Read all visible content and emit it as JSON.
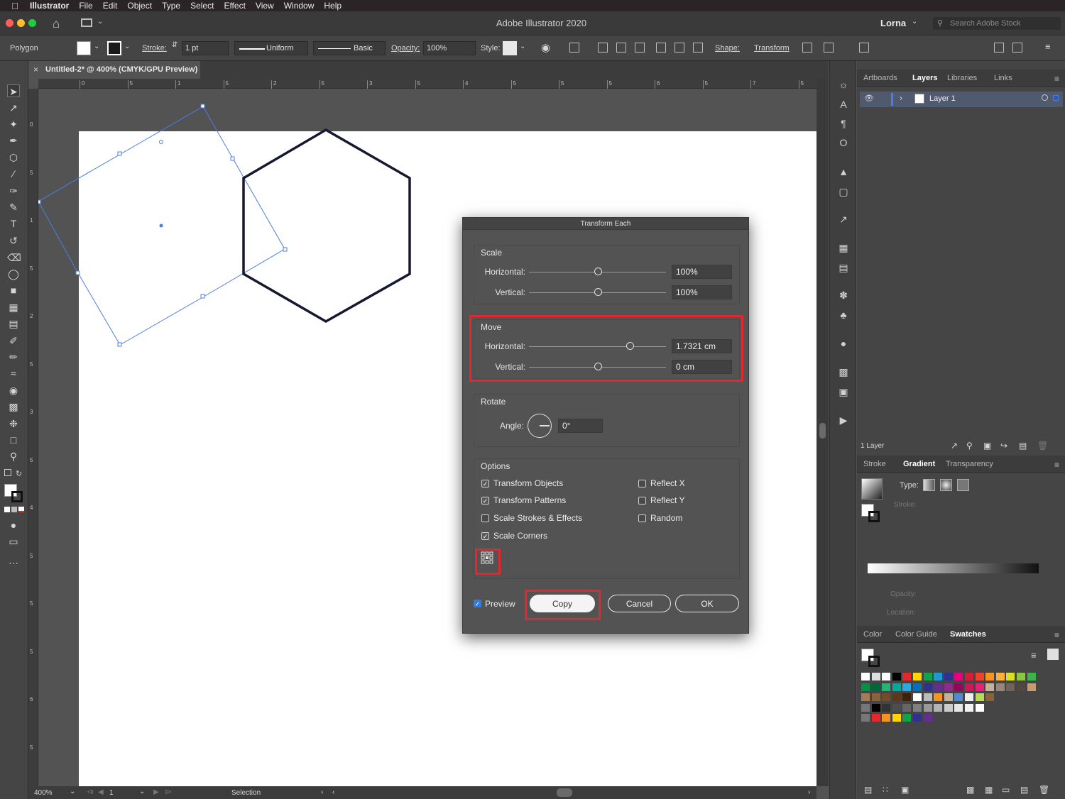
{
  "menubar": {
    "app_name": "Illustrator",
    "items": [
      "File",
      "Edit",
      "Object",
      "Type",
      "Select",
      "Effect",
      "View",
      "Window",
      "Help"
    ]
  },
  "titlebar": {
    "title": "Adobe Illustrator 2020",
    "user": "Lorna",
    "search_placeholder": "Search Adobe Stock"
  },
  "controlbar": {
    "selection_label": "Polygon",
    "stroke_label": "Stroke:",
    "stroke_weight": "1 pt",
    "profile_uniform": "Uniform",
    "brush_basic": "Basic",
    "opacity_label": "Opacity:",
    "opacity_value": "100%",
    "style_label": "Style:",
    "shape_label": "Shape:",
    "transform_label": "Transform"
  },
  "document": {
    "tab_title": "Untitled-2* @ 400% (CMYK/GPU Preview)"
  },
  "rulers": {
    "h_ticks": [
      "0",
      "5",
      "1",
      "5",
      "2",
      "5",
      "3",
      "5",
      "4",
      "5",
      "5",
      "5",
      "6",
      "5",
      "7",
      "5"
    ],
    "v_ticks": [
      "0",
      "5",
      "1",
      "5",
      "2",
      "5",
      "3",
      "5",
      "4",
      "5",
      "5",
      "5",
      "6",
      "5"
    ]
  },
  "statusbar": {
    "zoom": "400%",
    "artboard_num": "1",
    "tool_name": "Selection"
  },
  "dialog": {
    "title": "Transform Each",
    "scale": {
      "title": "Scale",
      "horizontal_label": "Horizontal:",
      "horizontal_value": "100%",
      "vertical_label": "Vertical:",
      "vertical_value": "100%"
    },
    "move": {
      "title": "Move",
      "horizontal_label": "Horizontal:",
      "horizontal_value": "1.7321 cm",
      "vertical_label": "Vertical:",
      "vertical_value": "0 cm"
    },
    "rotate": {
      "title": "Rotate",
      "angle_label": "Angle:",
      "angle_value": "0°"
    },
    "options": {
      "title": "Options",
      "transform_objects": "Transform Objects",
      "transform_patterns": "Transform Patterns",
      "scale_strokes": "Scale Strokes & Effects",
      "scale_corners": "Scale Corners",
      "reflect_x": "Reflect X",
      "reflect_y": "Reflect Y",
      "random": "Random"
    },
    "checked": {
      "transform_objects": true,
      "transform_patterns": true,
      "scale_strokes": false,
      "scale_corners": true,
      "reflect_x": false,
      "reflect_y": false,
      "random": false,
      "preview": true
    },
    "preview_label": "Preview",
    "copy_label": "Copy",
    "cancel_label": "Cancel",
    "ok_label": "OK",
    "highlight_color": "#e5262d"
  },
  "layers_panel": {
    "tabs": [
      "Artboards",
      "Layers",
      "Libraries",
      "Links"
    ],
    "active_tab": "Layers",
    "layer_name": "Layer 1",
    "layer_count": "1 Layer"
  },
  "gradient_panel": {
    "tabs": [
      "Stroke",
      "Gradient",
      "Transparency"
    ],
    "type_label": "Type:",
    "stroke_label": "Stroke:",
    "opacity_label": "Opacity:",
    "location_label": "Location:"
  },
  "swatches_panel": {
    "tabs": [
      "Color",
      "Color Guide",
      "Swatches"
    ]
  },
  "colors": {
    "selection_blue": "#4a7fe0",
    "hexagon_stroke": "#15182e",
    "layer_row": "#505a6e"
  }
}
